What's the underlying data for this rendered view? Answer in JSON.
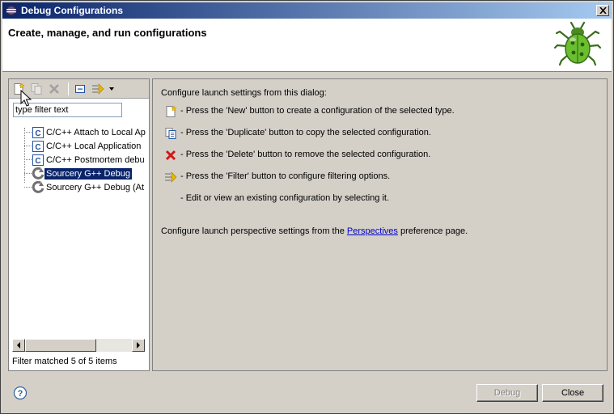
{
  "window": {
    "title": "Debug Configurations",
    "heading": "Create, manage, and run configurations"
  },
  "left_panel": {
    "filter": {
      "placeholder": "type filter text",
      "value": "type filter text"
    },
    "tree_items": [
      {
        "label": "C/C++ Attach to Local Ap",
        "icon": "c-config-icon",
        "selected": false
      },
      {
        "label": "C/C++ Local Application",
        "icon": "c-config-icon",
        "selected": false
      },
      {
        "label": "C/C++ Postmortem debu",
        "icon": "c-config-icon",
        "selected": false
      },
      {
        "label": "Sourcery G++ Debug",
        "icon": "sourcery-icon",
        "selected": true
      },
      {
        "label": "Sourcery G++ Debug (At",
        "icon": "sourcery-icon",
        "selected": false
      }
    ],
    "filter_status": "Filter matched 5 of 5 items"
  },
  "right_panel": {
    "intro": "Configure launch settings from this dialog:",
    "lines": [
      {
        "icon": "new-icon",
        "text": "- Press the 'New' button to create a configuration of the selected type."
      },
      {
        "icon": "duplicate-icon",
        "text": "- Press the 'Duplicate' button to copy the selected configuration."
      },
      {
        "icon": "delete-icon",
        "text": "- Press the 'Delete' button to remove the selected configuration."
      },
      {
        "icon": "filter-icon",
        "text": "- Press the 'Filter' button to configure filtering options."
      },
      {
        "icon": "",
        "text": "- Edit or view an existing configuration by selecting it."
      }
    ],
    "perspective_prefix": "Configure launch perspective settings from the",
    "perspective_link": "Perspectives",
    "perspective_suffix": "preference page."
  },
  "buttons": {
    "debug": "Debug",
    "close": "Close"
  },
  "colors": {
    "selection": "#0a246a",
    "link": "#0000cc",
    "dialog_bg": "#d4d0c8"
  }
}
